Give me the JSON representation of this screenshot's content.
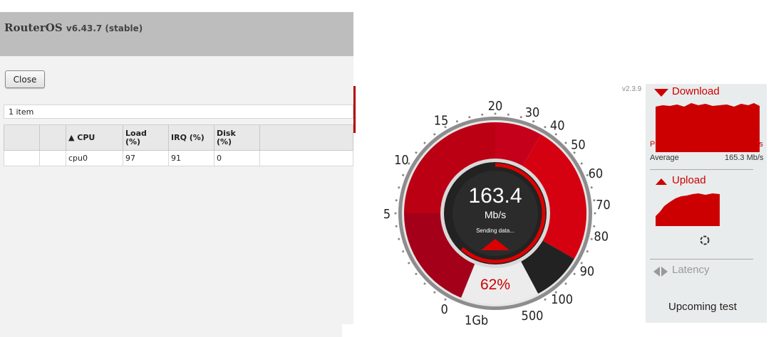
{
  "routeros": {
    "title": "RouterOS",
    "version": "v6.43.7 (stable)",
    "close_label": "Close",
    "item_count": "1 item",
    "columns": [
      "",
      "",
      "▲ CPU",
      "Load\n(%)",
      "IRQ (%)",
      "Disk\n(%)",
      ""
    ],
    "rows": [
      {
        "cpu": "cpu0",
        "load": "97",
        "irq": "91",
        "disk": "0"
      }
    ]
  },
  "speedtest": {
    "version": "v2.3.9",
    "speed_value": "163.4",
    "speed_unit": "Mb/s",
    "status": "Sending data...",
    "progress_label": "62%",
    "progress_fraction": 0.62,
    "needle_value_mbps": 163.4,
    "scale_labels": [
      "0",
      "5",
      "10",
      "15",
      "20",
      "30",
      "40",
      "50",
      "60",
      "70",
      "80",
      "90",
      "100",
      "500",
      "1Gb"
    ],
    "download": {
      "label": "Download",
      "peak_label": "Peak",
      "peak_value": "170.9",
      "peak_unit": "Mb/s",
      "average_label": "Average",
      "average_value": "165.3 Mb/s"
    },
    "upload": {
      "label": "Upload"
    },
    "latency": {
      "label": "Latency"
    },
    "upcoming": "Upcoming test",
    "colors": {
      "accent": "#cc0000",
      "dark_red": "#8b0010",
      "gauge_dark": "#222222"
    }
  }
}
